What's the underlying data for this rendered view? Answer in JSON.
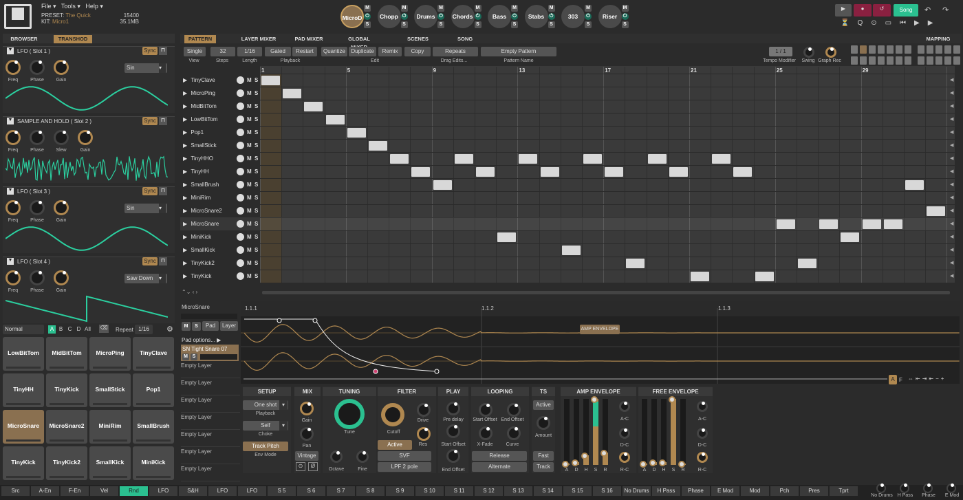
{
  "menu": {
    "file": "File ▾",
    "tools": "Tools ▾",
    "help": "Help ▾"
  },
  "preset": {
    "preset_label": "PRESET:",
    "preset_name": "The Quick",
    "kit_label": "KIT:",
    "kit_name": "Micro1",
    "val1": "15400",
    "val2": "35.1MB"
  },
  "kits": [
    "MicroD",
    "Chopp",
    "Drums",
    "Chords",
    "Bass",
    "Stabs",
    "303",
    "Riser"
  ],
  "transport": {
    "song": "Song"
  },
  "left_tabs": {
    "browser": "BROWSER",
    "transhod": "TRANSHOD"
  },
  "slots": [
    {
      "title": "LFO ( Slot 1 )",
      "knobs": [
        "Freq",
        "Phase",
        "Gain"
      ],
      "shape": "Sin",
      "sync": "Sync"
    },
    {
      "title": "SAMPLE AND HOLD ( Slot 2 )",
      "knobs": [
        "Freq",
        "Phase",
        "Slew",
        "Gain"
      ],
      "sync": "Sync"
    },
    {
      "title": "LFO ( Slot 3 )",
      "knobs": [
        "Freq",
        "Phase",
        "Gain"
      ],
      "shape": "Sin",
      "sync": "Sync"
    },
    {
      "title": "LFO ( Slot 4 )",
      "knobs": [
        "Freq",
        "Phase",
        "Gain"
      ],
      "shape": "Saw Down",
      "sync": "Sync"
    }
  ],
  "pad_bar": {
    "mode": "Normal",
    "banks": [
      "A",
      "B",
      "C",
      "D",
      "All"
    ],
    "repeat": "Repeat",
    "repeat_val": "1/16"
  },
  "pads": [
    "LowBitTom",
    "MidBitTom",
    "MicroPing",
    "TinyClave",
    "TinyHH",
    "TinyKick",
    "SmallStick",
    "Pop1",
    "MicroSnare",
    "MicroSnare2",
    "MiniRim",
    "SmallBrush",
    "TinyKick",
    "TinyKick2",
    "SmallKick",
    "MiniKick"
  ],
  "top_tabs": [
    "PATTERN",
    "LAYER MIXER",
    "PAD MIXER",
    "GLOBAL MIXER",
    "SCENES",
    "SONG",
    "MAPPING"
  ],
  "toolbar": {
    "single": "Single",
    "steps": "32",
    "length": "1/16",
    "gated": "Gated",
    "restart": "Restart",
    "quantize": "Quantize",
    "duplicate": "Duplicate",
    "remix": "Remix",
    "copy": "Copy",
    "repeats": "Repeats",
    "pattern_name": "Empty Pattern",
    "view": "View",
    "steps_lbl": "Steps",
    "length_lbl": "Length",
    "playback": "Playback",
    "edit": "Edit",
    "drag": "Drag Edits...",
    "pname_lbl": "Pattern Name",
    "tempo": "1 / 1",
    "tempo_lbl": "Tempo Modifier",
    "swing": "Swing",
    "graph": "Graph Rec"
  },
  "bar_numbers": [
    "1",
    "5",
    "9",
    "13",
    "17",
    "21",
    "25",
    "29"
  ],
  "tracks": [
    "TinyClave",
    "MicroPing",
    "MidBitTom",
    "LowBitTom",
    "Pop1",
    "SmallStick",
    "TinyHHO",
    "TinyHH",
    "SmallBrush",
    "MiniRim",
    "MicroSnare2",
    "MicroSnare",
    "MiniKick",
    "SmallKick",
    "TinyKick2",
    "TinyKick"
  ],
  "layer": {
    "pad_name": "MicroSnare",
    "pad": "Pad",
    "layer": "Layer",
    "pad_options": "Pad options...",
    "sample": "SN Tight Snare 07",
    "empty": "Empty Layer"
  },
  "wave": {
    "m1": "1.1.1",
    "m2": "1.1.2",
    "m3": "1.1.3",
    "env": "AMP ENVELOPE",
    "a": "A",
    "f": "F"
  },
  "sections": {
    "setup": "SETUP",
    "mix": "MIX",
    "tuning": "TUNING",
    "filter": "FILTER",
    "play": "PLAY",
    "looping": "LOOPING",
    "ts": "TS",
    "amp": "AMP ENVELOPE",
    "free": "FREE ENVELOPE",
    "oneshot": "One shot",
    "playback": "Playback",
    "self": "Self",
    "choke": "Choke",
    "trackpitch": "Track Pitch",
    "envmode": "Env Mode",
    "gain": "Gain",
    "pan": "Pan",
    "vintage": "Vintage",
    "tune": "Tune",
    "octave": "Octave",
    "fine": "Fine",
    "cutoff": "Cutoff",
    "drive": "Drive",
    "res": "Res",
    "active": "Active",
    "svf": "SVF",
    "lpf": "LPF 2 pole",
    "predelay": "Pre delay",
    "startoff": "Start Offset",
    "endoff": "End Offset",
    "lstart": "Start Offset",
    "lend": "End Offset",
    "xfade": "X-Fade",
    "curve": "Curve",
    "release": "Release",
    "alternate": "Alternate",
    "ts_active": "Active",
    "amount": "Amount",
    "fast": "Fast",
    "track": "Track",
    "env": [
      "A",
      "D",
      "H",
      "S",
      "R"
    ],
    "ac": "A-C",
    "dc": "D-C",
    "rc": "R-C"
  },
  "bottom_tabs": [
    "Src",
    "A-En",
    "F-En",
    "Vel",
    "Rnd",
    "LFO",
    "S&H",
    "LFO",
    "LFO",
    "S 5",
    "S 6",
    "S 7",
    "S 8",
    "S 9",
    "S 10",
    "S 11",
    "S 12",
    "S 13",
    "S 14",
    "S 15",
    "S 16",
    "No Drums",
    "H Pass",
    "Phase",
    "E Mod",
    "Mod",
    "Pch",
    "Pres",
    "Tprt"
  ],
  "corner": [
    "No Drums",
    "H Pass",
    "Phase",
    "E Mod"
  ]
}
